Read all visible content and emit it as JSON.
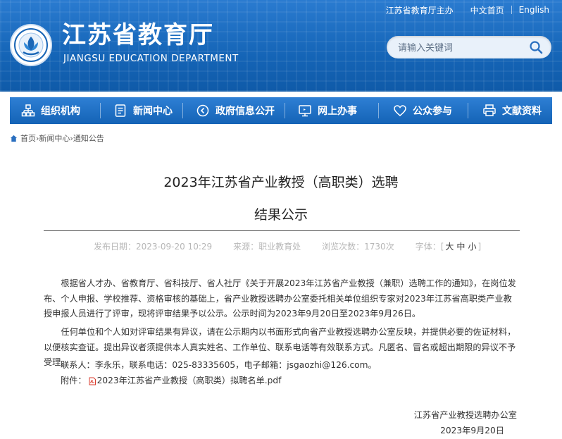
{
  "topbar": {
    "main_site": "江苏省教育厅主办",
    "cn_home": "中文首页",
    "english": "English"
  },
  "logo": {
    "cn": "江苏省教育厅",
    "en": "JIANGSU EDUCATION DEPARTMENT"
  },
  "search": {
    "placeholder": "请输入关键词",
    "icon": "search-icon"
  },
  "nav": {
    "items": [
      {
        "label": "组织机构",
        "icon": "org-chart-icon"
      },
      {
        "label": "新闻中心",
        "icon": "document-icon"
      },
      {
        "label": "政府信息公开",
        "icon": "info-disclosure-icon"
      },
      {
        "label": "网上办事",
        "icon": "monitor-icon"
      },
      {
        "label": "公众参与",
        "icon": "heart-icon"
      },
      {
        "label": "文献资料",
        "icon": "printer-icon"
      }
    ]
  },
  "breadcrumb": {
    "home": "首页",
    "news": "新闻中心",
    "notices": "通知公告",
    "separator": "›"
  },
  "article": {
    "title_line1": "2023年江苏省产业教授（高职类）选聘",
    "title_line2": "结果公示",
    "meta": {
      "published": "发布日期：2023-09-20 10:29",
      "source": "来源：职业教育处",
      "views": "浏览次数：1730次",
      "font_label": "字体：",
      "bracket_open": "[",
      "size_large": "大",
      "size_medium": "中",
      "size_small": "小",
      "bracket_close": "]"
    },
    "para1": "根据省人才办、省教育厅、省科技厅、省人社厅《关于开展2023年江苏省产业教授（兼职）选聘工作的通知》，在岗位发布、个人申报、学校推荐、资格审核的基础上，省产业教授选聘办公室委托相关单位组织专家对2023年江苏省高职类产业教授申报人员进行了评审，现将评审结果予以公示。公示时间为2023年9月20日至2023年9月26日。",
    "para2": "任何单位和个人如对评审结果有异议，请在公示期内以书面形式向省产业教授选聘办公室反映，并提供必要的佐证材料，以便核实查证。提出异议者须提供本人真实姓名、工作单位、联系电话等有效联系方式。凡匿名、冒名或超出期限的异议不予受理。",
    "contact": "联系人：李永乐，联系电话：025-83335605，电子邮箱：jsgaozhi@126.com。",
    "attachment_label": "附件：",
    "attachment_file": "2023年江苏省产业教授（高职类）拟聘名单.pdf",
    "signature_org": "江苏省产业教授选聘办公室",
    "signature_date": "2023年9月20日"
  },
  "colors": {
    "header_blue": "#1a66b6",
    "nav_blue": "#1463b6",
    "pdf_red": "#d93a2b"
  }
}
